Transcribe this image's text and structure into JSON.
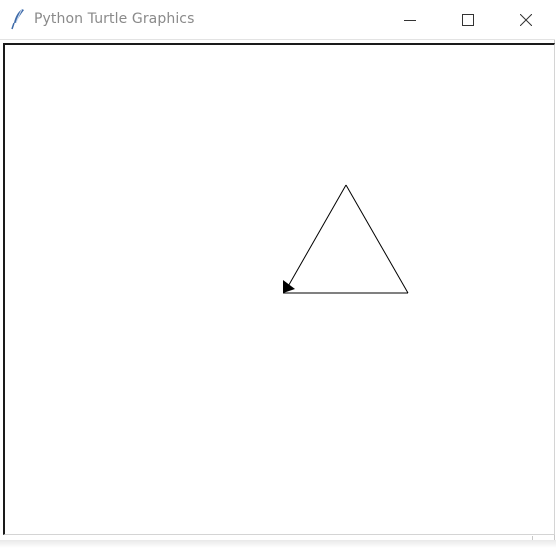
{
  "window": {
    "title": "Python Turtle Graphics",
    "icon": "feather-icon"
  },
  "controls": {
    "minimize_icon": "minimize-icon",
    "maximize_icon": "maximize-icon",
    "close_icon": "close-icon"
  },
  "drawing": {
    "shape": "equilateral triangle",
    "pen_color": "#000000",
    "background": "#ffffff",
    "turtle_heading": "towards lower-left"
  }
}
